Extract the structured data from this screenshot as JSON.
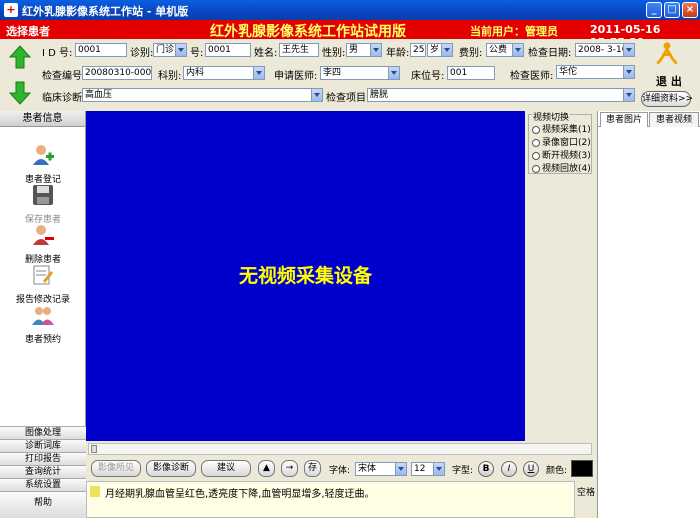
{
  "window": {
    "title": "红外乳腺影像系统工作站 - 单机版"
  },
  "header": {
    "select_patient": "选择患者",
    "system_title": "红外乳腺影像系统工作站试用版",
    "current_user": "当前用户：管理员",
    "datetime": "2011-05-16  15:55:21"
  },
  "form": {
    "id_label": "I D 号:",
    "id_value": "0001",
    "diag_type_label": "诊别:",
    "diag_type_value": "门诊",
    "number_label": "号:",
    "number_value": "0001",
    "name_label": "姓名:",
    "name_value": "王先生",
    "gender_label": "性别:",
    "gender_value": "男",
    "age_label": "年龄:",
    "age_value": "25",
    "age_unit": "岁",
    "fee_label": "费别:",
    "fee_value": "公费",
    "exam_date_label": "检查日期:",
    "exam_date_value": "2008- 3-10",
    "exam_no_label": "检查编号:",
    "exam_no_value": "20080310-000001",
    "dept_label": "科别:",
    "dept_value": "内科",
    "req_doctor_label": "申请医师:",
    "req_doctor_value": "李四",
    "bed_label": "床位号:",
    "bed_value": "001",
    "exam_doctor_label": "检查医师:",
    "exam_doctor_value": "华佗",
    "clinical_label": "临床诊断:",
    "clinical_value": "高血压",
    "exam_item_label": "检查项目:",
    "exam_item_value": "膀胱",
    "exit_label": "退  出",
    "detail_button": "详细资料>>"
  },
  "left_panel": {
    "header": "患者信息",
    "items": [
      {
        "label": "患者登记",
        "enabled": true
      },
      {
        "label": "保存患者",
        "enabled": false
      },
      {
        "label": "删除患者",
        "enabled": true
      },
      {
        "label": "报告修改记录",
        "enabled": true
      },
      {
        "label": "患者预约",
        "enabled": true
      }
    ],
    "bottom_items": [
      "图像处理",
      "诊断词库",
      "打印报告",
      "查询统计",
      "系统设置",
      "帮助"
    ]
  },
  "video": {
    "message": "无视频采集设备"
  },
  "video_switch": {
    "title": "视频切换",
    "options": [
      "视频采集(1)",
      "录像窗口(2)",
      "断开视频(3)",
      "视频回放(4)"
    ]
  },
  "right_panel": {
    "tabs": [
      "患者图片",
      "患者视频"
    ]
  },
  "toolbar": {
    "image_view": "影像所见",
    "image_diag": "影像诊断",
    "suggest": "建议",
    "up": "▲",
    "arrow": "→",
    "save": "存",
    "font_label": "字体:",
    "font_value": "宋体",
    "size_value": "12",
    "style_label": "字型:",
    "bold": "B",
    "italic": "I",
    "underline": "U",
    "color_label": "颜色:",
    "color_value": "#000000"
  },
  "notes": {
    "text": "月经期乳腺血管呈红色,透亮度下降,血管明显增多,轻度迂曲。",
    "space_label": "空格"
  }
}
